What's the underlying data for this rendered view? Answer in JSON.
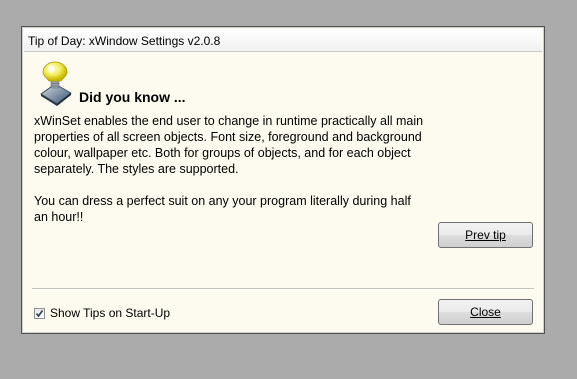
{
  "window": {
    "title": "Tip of Day: xWindow Settings v2.0.8"
  },
  "tip": {
    "icon": "lightbulb-icon",
    "heading": "Did you know ...",
    "paragraphs": [
      "xWinSet enables the end user to change in runtime practically all main properties of all screen objects. Font size, foreground and background colour, wallpaper etc. Both for groups of objects, and for each object separately. The styles are supported.",
      "You can dress a perfect suit on any your program literally during half an hour!!"
    ]
  },
  "buttons": {
    "prev_label": "Prev tip",
    "close_label": "Close"
  },
  "show_tips": {
    "label": "Show Tips on Start-Up",
    "checked": true
  }
}
